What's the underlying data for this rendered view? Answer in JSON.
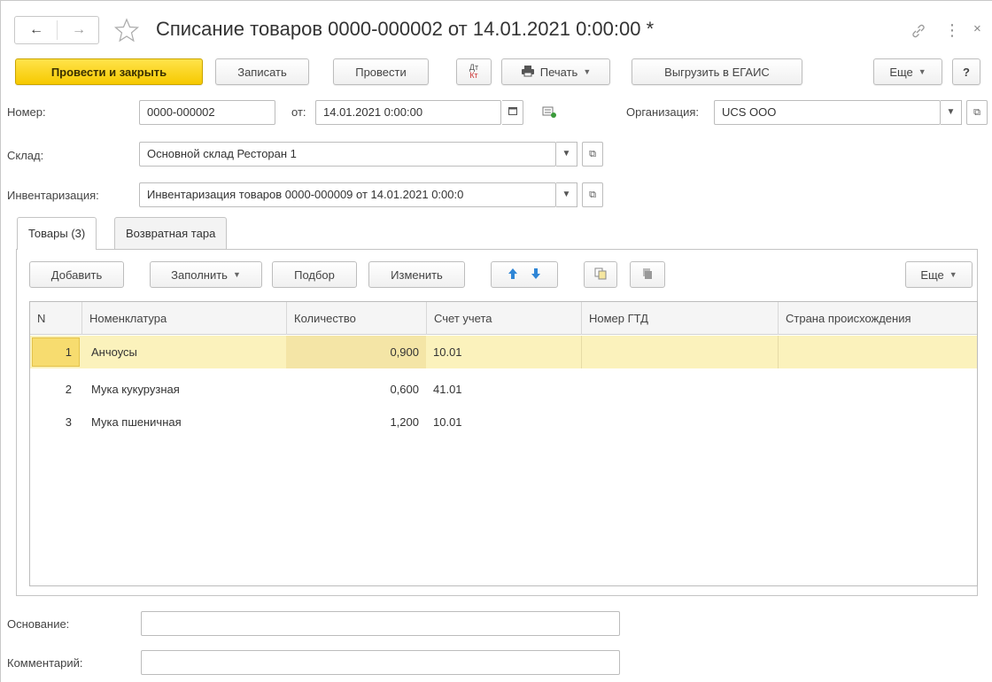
{
  "window": {
    "title": "Списание товаров 0000-000002 от 14.01.2021 0:00:00 *",
    "back_icon": "arrow-left-icon",
    "forward_icon": "arrow-right-icon"
  },
  "toolbar": {
    "post_close": "Провести и закрыть",
    "save": "Записать",
    "post": "Провести",
    "dtkt": "Дт Кт",
    "print": "Печать",
    "egais": "Выгрузить в ЕГАИС",
    "more": "Еще",
    "help": "?"
  },
  "form": {
    "number_label": "Номер:",
    "number_value": "0000-000002",
    "date_label": "от:",
    "date_value": "14.01.2021  0:00:00",
    "org_label": "Организация:",
    "org_value": "UCS ООО",
    "warehouse_label": "Склад:",
    "warehouse_value": "Основной склад Ресторан 1",
    "inventory_label": "Инвентаризация:",
    "inventory_value": "Инвентаризация товаров 0000-000009 от 14.01.2021 0:00:0",
    "basis_label": "Основание:",
    "basis_value": "",
    "comment_label": "Комментарий:",
    "comment_value": ""
  },
  "tabs": [
    {
      "label": "Товары (3)"
    },
    {
      "label": "Возвратная тара"
    }
  ],
  "table_toolbar": {
    "add": "Добавить",
    "fill": "Заполнить",
    "pick": "Подбор",
    "edit": "Изменить",
    "more": "Еще"
  },
  "table": {
    "columns": [
      "N",
      "Номенклатура",
      "Количество",
      "Счет учета",
      "Номер ГТД",
      "Страна происхождения"
    ],
    "rows": [
      {
        "n": "1",
        "name": "Анчоусы",
        "qty": "0,900",
        "account": "10.01",
        "gtd": "",
        "country": ""
      },
      {
        "n": "2",
        "name": "Мука кукурузная",
        "qty": "0,600",
        "account": "41.01",
        "gtd": "",
        "country": ""
      },
      {
        "n": "3",
        "name": "Мука пшеничная",
        "qty": "1,200",
        "account": "10.01",
        "gtd": "",
        "country": ""
      }
    ]
  },
  "colors": {
    "primary_button": "#f6c900",
    "selected_row": "#fbf2bc",
    "arrow_blue": "#2f86d6"
  }
}
